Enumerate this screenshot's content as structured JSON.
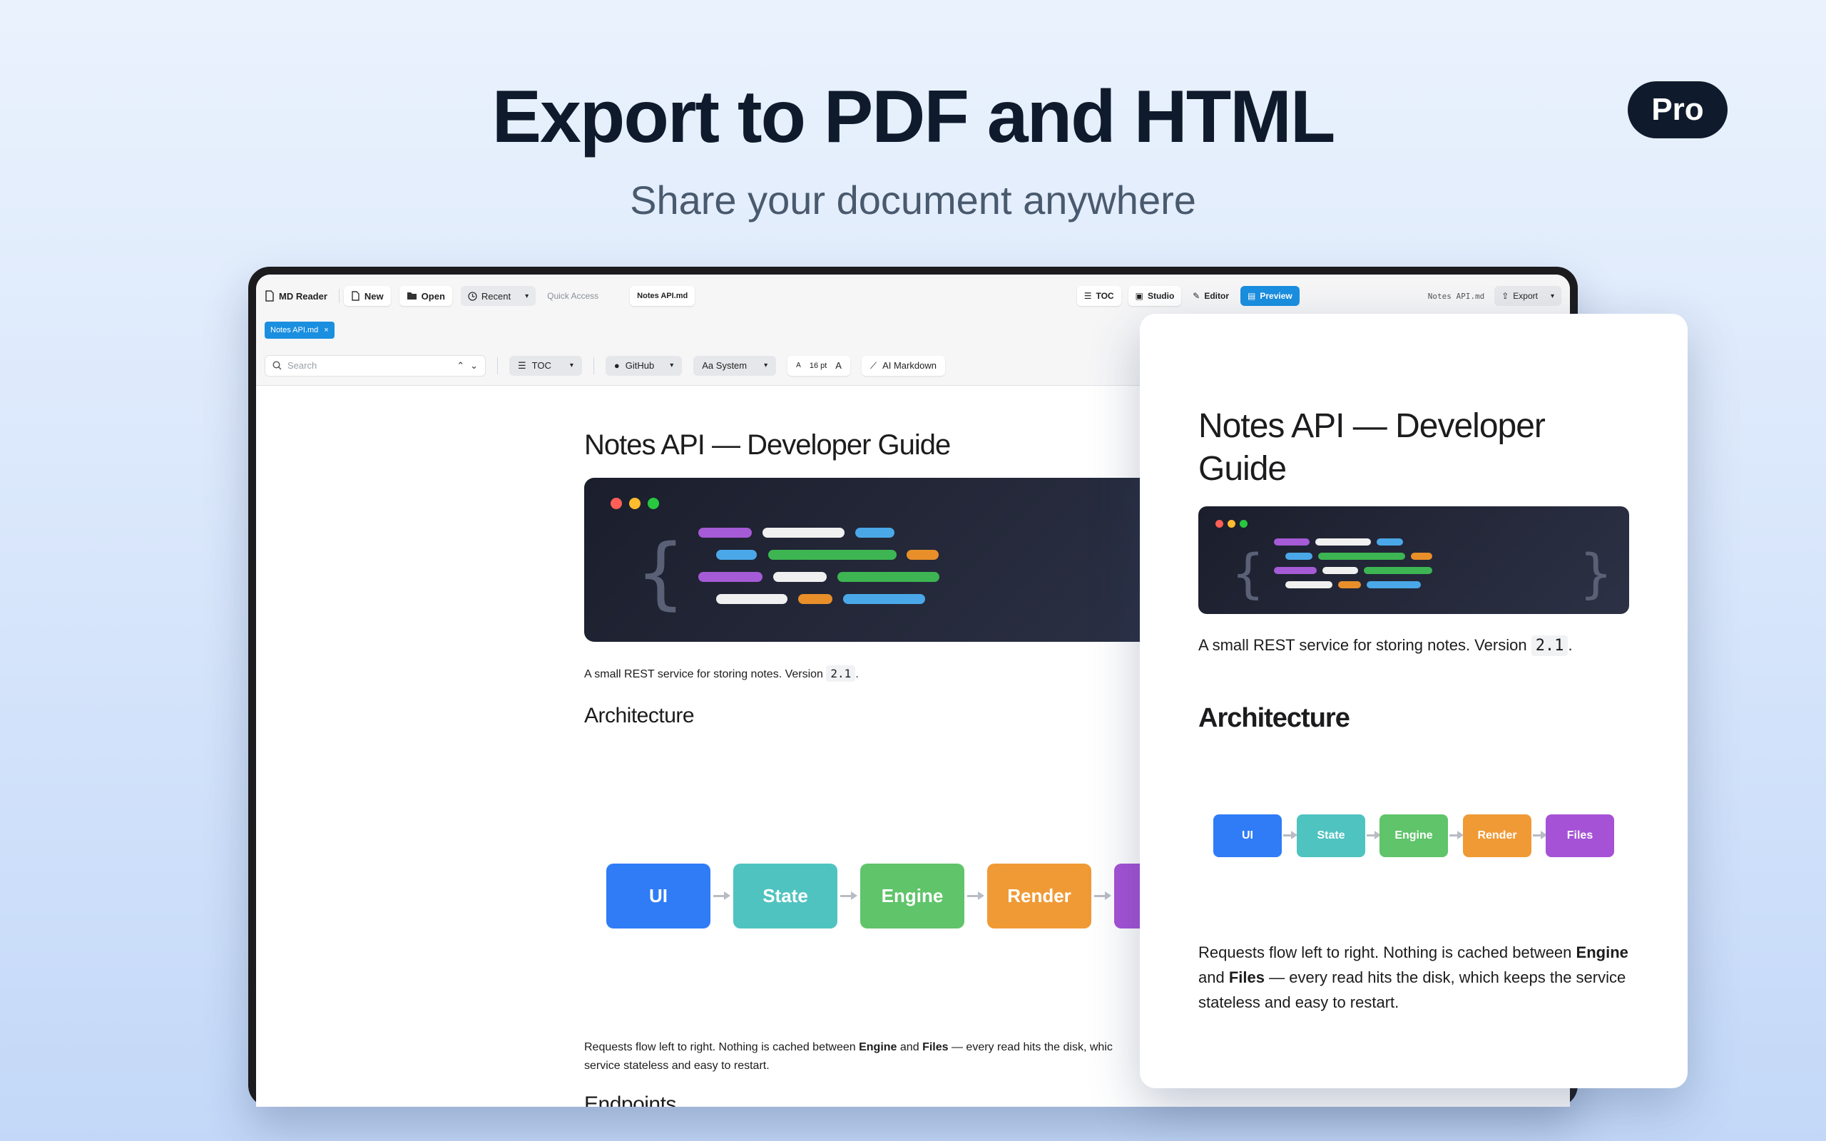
{
  "hero": {
    "title": "Export to PDF and HTML",
    "subtitle": "Share your document anywhere",
    "badge": "Pro"
  },
  "toolbar": {
    "app_name": "MD Reader",
    "new_label": "New",
    "open_label": "Open",
    "recent_label": "Recent",
    "quick_access": "Quick Access",
    "file_chip": "Notes API.md",
    "toc_label": "TOC",
    "studio_label": "Studio",
    "editor_label": "Editor",
    "preview_label": "Preview",
    "filename": "Notes API.md",
    "export_label": "Export"
  },
  "tab": {
    "label": "Notes API.md",
    "close": "×"
  },
  "format_bar": {
    "search_placeholder": "Search",
    "toc": "TOC",
    "theme": "GitHub",
    "font": "Aa System",
    "size_small": "A",
    "size": "16 pt",
    "size_large": "A",
    "ai": "AI Markdown"
  },
  "document": {
    "title": "Notes API — Developer Guide",
    "intro_prefix": "A small REST service for storing notes. Version",
    "version": "2.1",
    "intro_suffix": ".",
    "section": "Architecture",
    "nodes": [
      "UI",
      "State",
      "Engine",
      "Render",
      "Files"
    ],
    "flow_1": "Requests flow left to right. Nothing is cached between",
    "flow_bold1": "Engine",
    "flow_2": "and",
    "flow_bold2": "Files",
    "flow_3": "— every read hits the disk, which keeps the service stateless and easy to restart.",
    "flow_3_short": "— every read hits the disk, whic",
    "flow_line2": "service stateless and easy to restart.",
    "next_heading": "Endpoints"
  },
  "colors": {
    "node_ui": "#2f7cf6",
    "node_state": "#4fc3c0",
    "node_engine": "#5fc46a",
    "node_render": "#f09a36",
    "node_files": "#a552d6",
    "preview_accent": "#1a8fe0"
  },
  "icons": [
    "document-icon",
    "new-file-icon",
    "folder-icon",
    "clock-icon",
    "chevron-down-icon",
    "list-icon",
    "studio-icon",
    "edit-icon",
    "preview-icon",
    "export-icon",
    "search-icon",
    "github-icon",
    "wand-icon",
    "close-icon"
  ]
}
